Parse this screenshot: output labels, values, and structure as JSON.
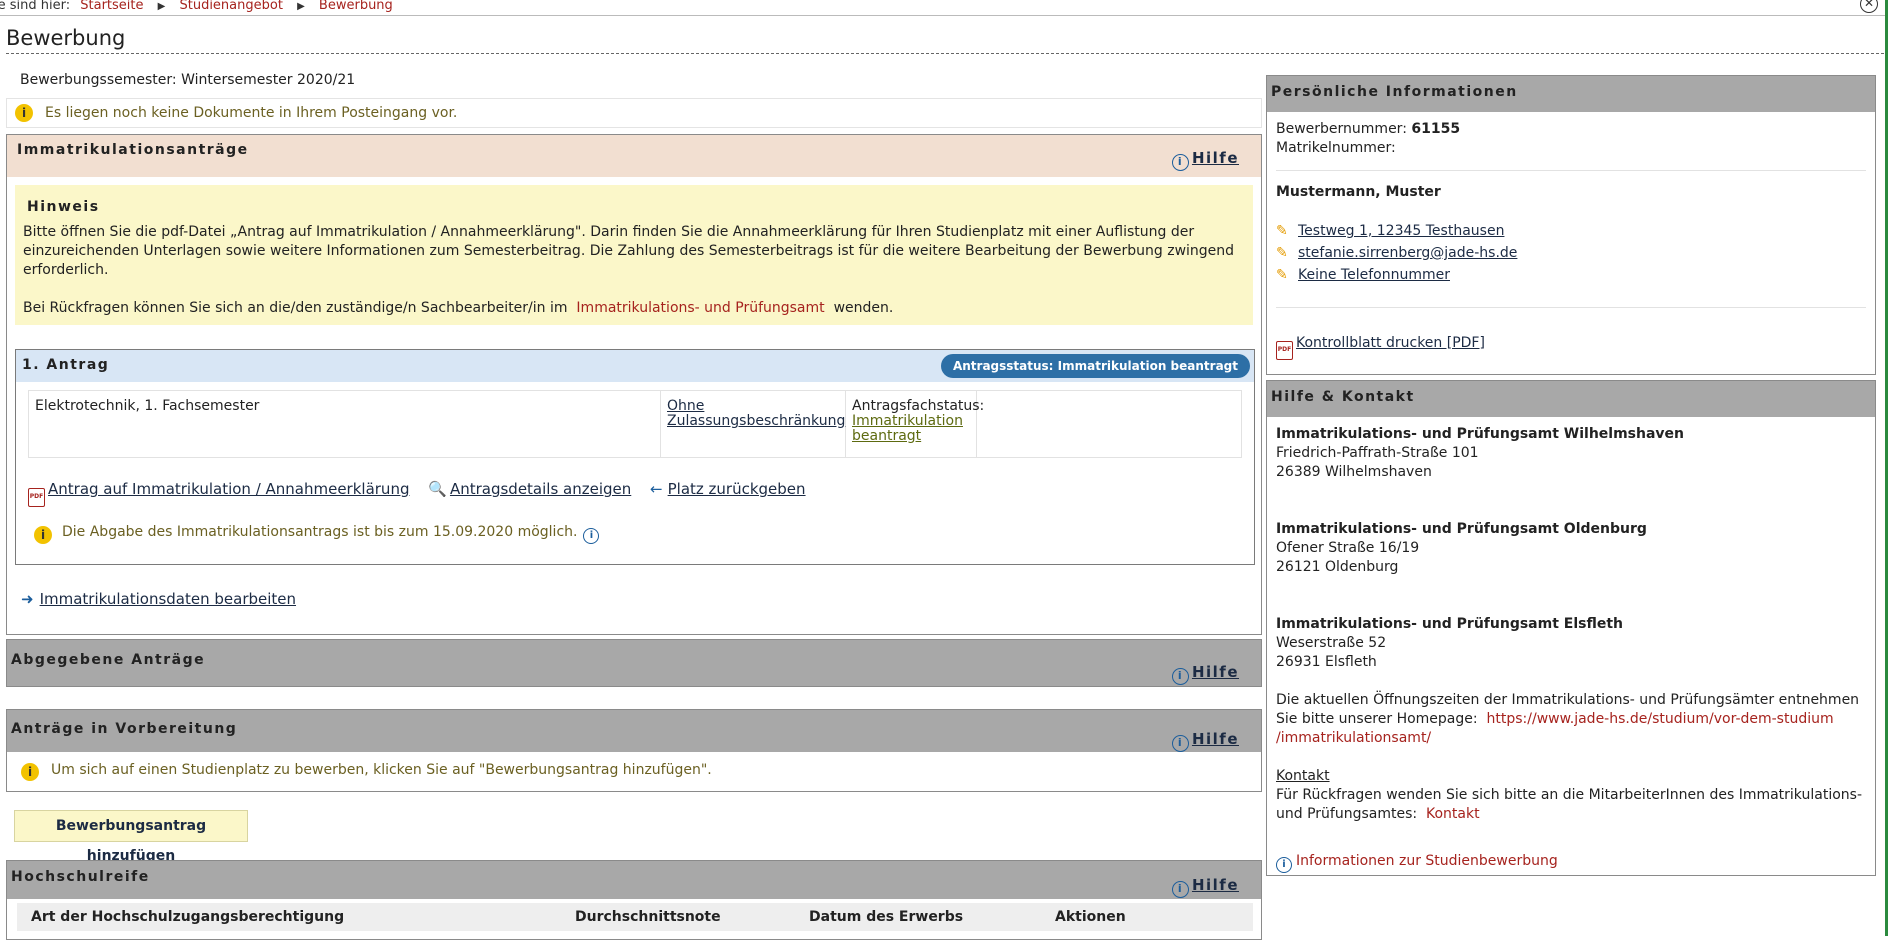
{
  "breadcrumb": {
    "prefix": "ie sind hier:",
    "items": [
      "Startseite",
      "Studienangebot",
      "Bewerbung"
    ]
  },
  "page": {
    "title": "Bewerbung"
  },
  "semester_label": "Bewerbungssemester: Wintersemester 2020/21",
  "inbox_note": "Es liegen noch keine Dokumente in Ihrem Posteingang vor.",
  "hilfe_label": "Hilfe",
  "immatrikulation": {
    "title": "Immatrikulationsanträge",
    "hinweis_title": "Hinweis",
    "hinweis_text": "Bitte öffnen Sie die pdf-Datei „Antrag auf Immatrikulation / Annahmeerklärung\". Darin finden Sie die Annahmeerklärung für Ihren Studienplatz mit einer Auflistung der einzureichenden Unterlagen sowie weitere Informationen zum Semesterbeitrag. Die Zahlung des Semesterbeitrags ist für die weitere Bearbeitung der Bewerbung zwingend erforderlich.",
    "rueckfragen_prefix": "Bei Rückfragen können Sie sich an die/den zuständige/n Sachbearbeiter/in im",
    "rueckfragen_link": "Immatrikulations- und Prüfungsamt",
    "rueckfragen_suffix": "wenden.",
    "antrag": {
      "title": "1. Antrag",
      "status": "Antragsstatus: Immatrikulation beantragt",
      "studiengang": "Elektrotechnik, 1. Fachsemester",
      "zulassung": "Ohne Zulassungsbeschränkung",
      "fachstatus_label": "Antragsfachstatus:",
      "fachstatus_value": "Immatrikulation beantragt",
      "action_pdf": "Antrag auf Immatrikulation / Annahmeerklärung",
      "action_details": "Antragsdetails anzeigen",
      "action_return": "Platz zurückgeben",
      "deadline": "Die Abgabe des Immatrikulationsantrags ist bis zum 15.09.2020 möglich."
    },
    "edit_link": "Immatrikulationsdaten bearbeiten"
  },
  "abgegeben": {
    "title": "Abgegebene Anträge"
  },
  "vorbereitung": {
    "title": "Anträge in Vorbereitung",
    "note": "Um sich auf einen Studienplatz zu bewerben, klicken Sie auf \"Bewerbungsantrag hinzufügen\"."
  },
  "add_button": "Bewerbungsantrag hinzufügen",
  "hochschulreife": {
    "title": "Hochschulreife",
    "columns": [
      "Art der Hochschulzugangsberechtigung",
      "Durchschnittsnote",
      "Datum des Erwerbs",
      "Aktionen"
    ]
  },
  "personal": {
    "title": "Persönliche Informationen",
    "bewerbernummer_label": "Bewerbernummer:",
    "bewerbernummer": "61155",
    "matrikel_label": "Matrikelnummer:",
    "name": "Mustermann, Muster",
    "address": "Testweg 1, 12345 Testhausen",
    "email": "stefanie.sirrenberg@jade-hs.de",
    "phone": "Keine Telefonnummer",
    "print_link": "Kontrollblatt drucken [PDF]"
  },
  "kontakt": {
    "title": "Hilfe & Kontakt",
    "offices": [
      {
        "name": "Immatrikulations- und Prüfungsamt Wilhelmshaven",
        "street": "Friedrich-Paffrath-Straße 101",
        "city": "26389 Wilhelmshaven"
      },
      {
        "name": "Immatrikulations- und Prüfungsamt Oldenburg",
        "street": "Ofener Straße 16/19",
        "city": "26121 Oldenburg"
      },
      {
        "name": "Immatrikulations- und Prüfungsamt Elsfleth",
        "street": "Weserstraße 52",
        "city": "26931 Elsfleth"
      }
    ],
    "hours_text": "Die aktuellen Öffnungszeiten der Immatrikulations- und Prüfungsämter entnehmen Sie bitte unserer Homepage:",
    "hours_url_1": "https://www.jade-hs.de/studium/vor-dem-studium",
    "hours_url_2": "/immatrikulationsamt/",
    "kontakt_heading": "Kontakt",
    "kontakt_text": "Für Rückfragen wenden Sie sich bitte an die MitarbeiterInnen des Immatrikulations- und Prüfungsamtes:",
    "kontakt_link": "Kontakt",
    "info_link": "Informationen zur Studienbewerbung"
  },
  "colors": {
    "accent_red": "#a6231e",
    "status_blue": "#2d6fa6",
    "note_yellow": "#fbf7c9",
    "panel_gray": "#a8a8a8",
    "immat_head": "#f2dfd1"
  }
}
